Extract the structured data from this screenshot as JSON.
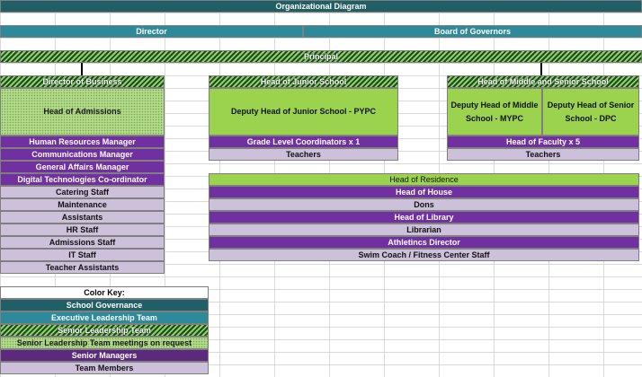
{
  "title": "Organizational Diagram",
  "top": {
    "director": "Director",
    "board": "Board of Governors",
    "principal": "Principal"
  },
  "business": {
    "header": "Director of Business",
    "admissions": "Head of Admissions",
    "managers": [
      "Human Resources Manager",
      "Communications Manager",
      "General Affairs Manager",
      "Digital Technologies Co-ordinator"
    ],
    "staff": [
      "Catering Staff",
      "Maintenance",
      "Assistants",
      "HR Staff",
      "Admissions Staff",
      "IT Staff",
      "Teacher Assistants"
    ]
  },
  "junior": {
    "header": "Head of Junior School",
    "deputy": "Deputy Head of Junior School - PYPC",
    "coordinators": "Grade Level Coordinators x 1",
    "teachers": "Teachers"
  },
  "senior": {
    "header": "Head of Middle and Senior School",
    "deputy_middle": "Deputy Head of Middle School - MYPC",
    "deputy_senior": "Deputy Head of Senior School - DPC",
    "faculty": "Head of Faculty x 5",
    "teachers": "Teachers"
  },
  "residence": {
    "header": "Head of Residence",
    "rows": [
      "Head of House",
      "Dons",
      "Head of Library",
      "Librarian",
      "Athletincs Director",
      "Swim Coach / Fitness Center Staff"
    ]
  },
  "key": {
    "title": "Color Key:",
    "items": [
      "School Governance",
      "Executive Leadership Team",
      "Senior Leadership Team",
      "Senior Leadership Team meetings on request",
      "Senior Managers",
      "Team Members"
    ]
  },
  "colors": {
    "governance": "#215f66",
    "executive": "#2d8a9a",
    "senior_leadership": "#2e6b34",
    "slt_on_request": "#b5dc8a",
    "senior_managers": "#7030a0",
    "team_members": "#ccc0da",
    "green_box": "#9bd34f"
  }
}
